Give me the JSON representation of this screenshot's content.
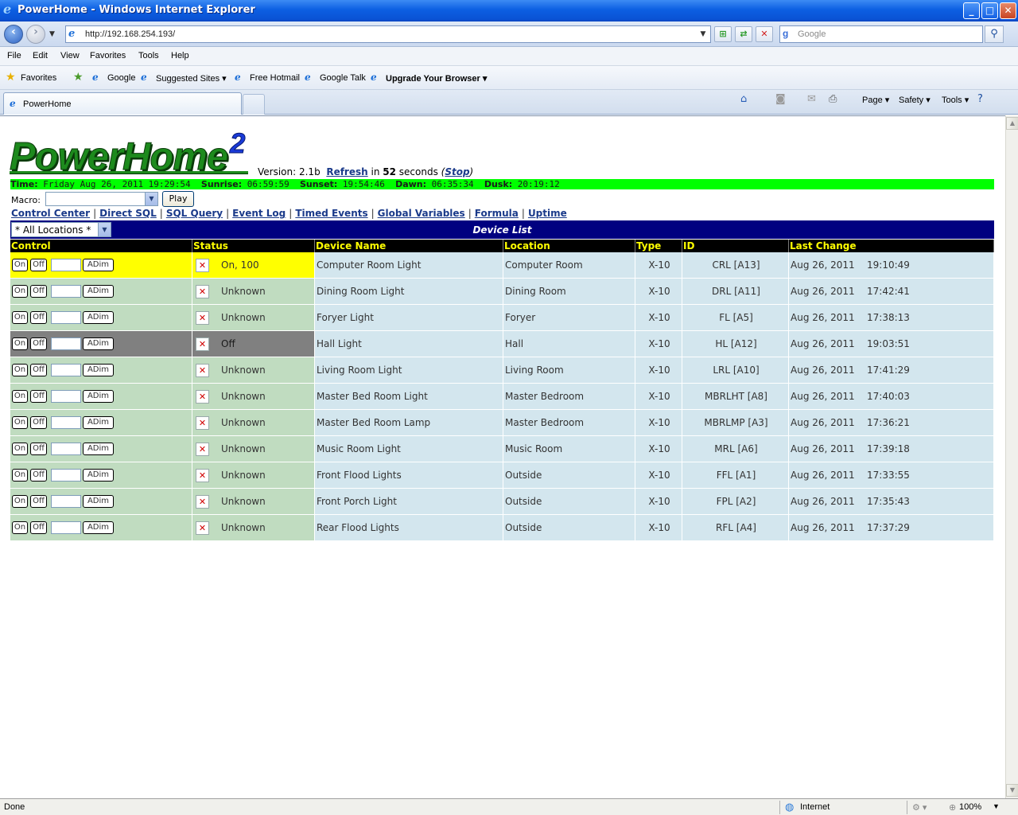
{
  "window": {
    "title": "PowerHome - Windows Internet Explorer",
    "controls": {
      "minimize": "_",
      "maximize": "□",
      "close": "✕"
    }
  },
  "addressbar": {
    "url": "http://192.168.254.193/",
    "search_placeholder": "Google"
  },
  "menu": [
    "File",
    "Edit",
    "View",
    "Favorites",
    "Tools",
    "Help"
  ],
  "favorites_bar": {
    "favorites_label": "Favorites",
    "links": [
      "Google",
      "Suggested Sites ▾",
      "Free Hotmail",
      "Google Talk",
      "Upgrade Your Browser ▾"
    ]
  },
  "tab": {
    "label": "PowerHome"
  },
  "command_bar": {
    "page": "Page ▾",
    "safety": "Safety ▾",
    "tools": "Tools ▾"
  },
  "header": {
    "logo_text": "PowerHome",
    "logo_superscript": "2",
    "version": "Version: 2.1b",
    "refresh_link": "Refresh",
    "refresh_in": " in ",
    "refresh_seconds": "52",
    "refresh_unit": " seconds ",
    "stop_link": "Stop"
  },
  "info_bar": {
    "time_label": "Time:",
    "time_value": "Friday Aug 26, 2011 19:29:54",
    "sunrise_label": "Sunrise:",
    "sunrise_value": "06:59:59",
    "sunset_label": "Sunset:",
    "sunset_value": "19:54:46",
    "dawn_label": "Dawn:",
    "dawn_value": "06:35:34",
    "dusk_label": "Dusk:",
    "dusk_value": "20:19:12"
  },
  "macro": {
    "label": "Macro:",
    "value": "",
    "play_button": "Play"
  },
  "nav_links": [
    "Control Center",
    "Direct SQL",
    "SQL Query",
    "Event Log",
    "Timed Events",
    "Global Variables",
    "Formula",
    "Uptime"
  ],
  "device_list": {
    "title": "Device List",
    "location_filter": "* All Locations *",
    "columns": [
      "Control",
      "Status",
      "Device Name",
      "Location",
      "Type",
      "ID",
      "Last Change"
    ],
    "buttons": {
      "on": "On",
      "off": "Off",
      "adim": "ADim"
    },
    "rows": [
      {
        "status": "On, 100",
        "state": "on",
        "name": "Computer Room Light",
        "location": "Computer Room",
        "type": "X-10",
        "id": "CRL [A13]",
        "date": "Aug 26, 2011",
        "time": "19:10:49"
      },
      {
        "status": "Unknown",
        "state": "unknown",
        "name": "Dining Room Light",
        "location": "Dining Room",
        "type": "X-10",
        "id": "DRL [A11]",
        "date": "Aug 26, 2011",
        "time": "17:42:41"
      },
      {
        "status": "Unknown",
        "state": "unknown",
        "name": "Foryer Light",
        "location": "Foryer",
        "type": "X-10",
        "id": "FL [A5]",
        "date": "Aug 26, 2011",
        "time": "17:38:13"
      },
      {
        "status": "Off",
        "state": "off",
        "name": "Hall Light",
        "location": "Hall",
        "type": "X-10",
        "id": "HL [A12]",
        "date": "Aug 26, 2011",
        "time": "19:03:51"
      },
      {
        "status": "Unknown",
        "state": "unknown",
        "name": "Living Room Light",
        "location": "Living Room",
        "type": "X-10",
        "id": "LRL [A10]",
        "date": "Aug 26, 2011",
        "time": "17:41:29"
      },
      {
        "status": "Unknown",
        "state": "unknown",
        "name": "Master Bed Room Light",
        "location": "Master Bedroom",
        "type": "X-10",
        "id": "MBRLHT [A8]",
        "date": "Aug 26, 2011",
        "time": "17:40:03"
      },
      {
        "status": "Unknown",
        "state": "unknown",
        "name": "Master Bed Room Lamp",
        "location": "Master Bedroom",
        "type": "X-10",
        "id": "MBRLMP [A3]",
        "date": "Aug 26, 2011",
        "time": "17:36:21"
      },
      {
        "status": "Unknown",
        "state": "unknown",
        "name": "Music Room Light",
        "location": "Music Room",
        "type": "X-10",
        "id": "MRL [A6]",
        "date": "Aug 26, 2011",
        "time": "17:39:18"
      },
      {
        "status": "Unknown",
        "state": "unknown",
        "name": "Front Flood Lights",
        "location": "Outside",
        "type": "X-10",
        "id": "FFL [A1]",
        "date": "Aug 26, 2011",
        "time": "17:33:55"
      },
      {
        "status": "Unknown",
        "state": "unknown",
        "name": "Front Porch Light",
        "location": "Outside",
        "type": "X-10",
        "id": "FPL [A2]",
        "date": "Aug 26, 2011",
        "time": "17:35:43"
      },
      {
        "status": "Unknown",
        "state": "unknown",
        "name": "Rear Flood Lights",
        "location": "Outside",
        "type": "X-10",
        "id": "RFL [A4]",
        "date": "Aug 26, 2011",
        "time": "17:37:29"
      }
    ]
  },
  "statusbar": {
    "left": "Done",
    "zone": "Internet",
    "zoom": "100%"
  },
  "colors": {
    "info_bar": "#00ff00",
    "header_bg": "#000080",
    "col_header_text": "#ffff00",
    "row_on": "#ffff00",
    "row_off": "#808080",
    "row_unknown": "#c0dcc0",
    "row_info": "#d3e6ee"
  },
  "icons": [
    "ie-logo-icon",
    "back-icon",
    "forward-icon",
    "refresh-icon",
    "stop-icon",
    "search-icon",
    "favorites-star-icon",
    "home-icon",
    "rss-icon",
    "mail-icon",
    "print-icon",
    "help-icon",
    "status-x-icon",
    "globe-icon"
  ]
}
